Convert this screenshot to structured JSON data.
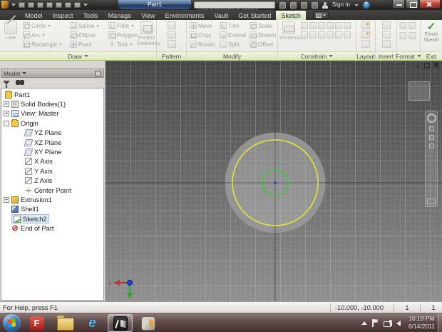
{
  "titlebar": {
    "document_title": "Part1",
    "search_placeholder": "Type a keyword or phrase",
    "sign_in_label": "Sign In",
    "help_glyph": "?"
  },
  "tabs": {
    "items": [
      "Model",
      "Inspect",
      "Tools",
      "Manage",
      "View",
      "Environments",
      "Vault",
      "Get Started",
      "Sketch"
    ],
    "active": "Sketch"
  },
  "ribbon": {
    "draw": {
      "panel_label": "Draw",
      "line": "Line",
      "circle": "Circle",
      "arc": "Arc",
      "rectangle": "Rectangle",
      "spline": "Spline",
      "ellipse": "Ellipse",
      "point": "Point",
      "fillet": "Fillet",
      "polygon": "Polygon",
      "text": "Text",
      "text_icon_glyph": "A",
      "project_geometry": "Project Geometry"
    },
    "pattern": {
      "panel_label": "Pattern"
    },
    "modify": {
      "panel_label": "Modify",
      "move": "Move",
      "copy": "Copy",
      "rotate": "Rotate",
      "trim": "Trim",
      "extend": "Extend",
      "split": "Split",
      "scale": "Scale",
      "stretch": "Stretch",
      "offset": "Offset"
    },
    "constrain": {
      "panel_label": "Constrain",
      "dimension": "Dimension"
    },
    "layout_panel": {
      "panel_label": "Layout"
    },
    "insert": {
      "panel_label": "Insert"
    },
    "format": {
      "panel_label": "Format"
    },
    "exit": {
      "panel_label": "Exit",
      "finish_sketch": "Finish Sketch",
      "check_glyph": "✓"
    }
  },
  "browser": {
    "header_title": "Model",
    "tree": [
      {
        "label": "Part1"
      },
      {
        "label": "Solid Bodies(1)",
        "expand": "+"
      },
      {
        "label": "View: Master",
        "expand": "+"
      },
      {
        "label": "Origin",
        "expand": "-"
      },
      {
        "label": "YZ Plane"
      },
      {
        "label": "XZ Plane"
      },
      {
        "label": "XY Plane"
      },
      {
        "label": "X Axis"
      },
      {
        "label": "Y Axis"
      },
      {
        "label": "Z Axis"
      },
      {
        "label": "Center Point"
      },
      {
        "label": "Extrusion1",
        "expand": "+"
      },
      {
        "label": "Shell1"
      },
      {
        "label": "Sketch2"
      },
      {
        "label": "End of Part",
        "glyph": "⊘"
      }
    ]
  },
  "canvas": {
    "x_axis_label": "x",
    "colors": {
      "sketch_circle_yellow": "#e4e43a",
      "inner_circle_green": "#3cc83c",
      "center_point_blue": "#2338c8",
      "background_top": "#464646",
      "background_bottom": "#909090"
    }
  },
  "statusbar": {
    "help_text": "For Help, press F1",
    "coordinates": "-10.000, -10.000",
    "grid_value_1": "1",
    "grid_value_2": "1"
  },
  "taskbar": {
    "tray_time": "10:18 PM",
    "tray_date": "6/14/2011",
    "app_f_glyph": "F",
    "app_ie_glyph": "e"
  }
}
